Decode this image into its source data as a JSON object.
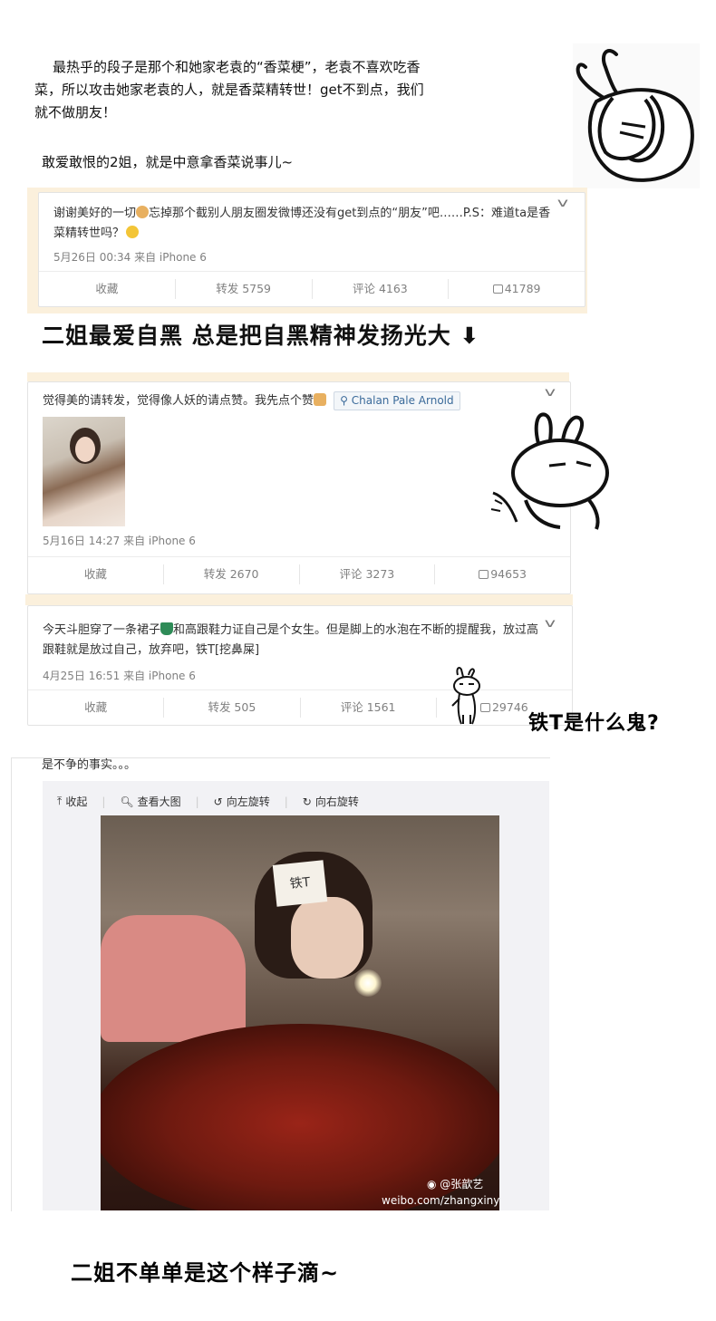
{
  "intro": {
    "line1": "最热乎的段子是那个和她家老袁的“香菜梗”，老袁不喜欢吃香菜，所以攻击她家老袁的人，就是香菜精转世！get不到点，我们就不做朋友！",
    "line2": "敢爱敢恨的2姐，就是中意拿香菜说事儿~"
  },
  "post1": {
    "text_a": "谢谢美好的一切",
    "text_b": "忘掉那个截别人朋友圈发微博还没有get到点的“朋友”吧……P.S：难道ta是香菜精转世吗？",
    "meta": "5月26日 00:34 来自 iPhone 6",
    "actions": [
      "收藏",
      "转发 5759",
      "评论 4163",
      "41789"
    ]
  },
  "caption1": "二姐最爱自黑 总是把自黑精神发扬光大 ⬇",
  "post2": {
    "text": "觉得美的请转发，觉得像人妖的请点赞。我先点个赞",
    "location": "Chalan Pale Arnold",
    "meta": "5月16日 14:27 来自 iPhone 6",
    "actions": [
      "收藏",
      "转发 2670",
      "评论 3273",
      "94653"
    ]
  },
  "post3": {
    "text_a": "今天斗胆穿了一条裙子",
    "text_b": "和高跟鞋力证自己是个女生。但是脚上的水泡在不断的提醒我，放过高跟鞋就是放过自己，放弃吧，铁T[挖鼻屎]",
    "meta": "4月25日 16:51 来自 iPhone 6",
    "actions": [
      "收藏",
      "转发 505",
      "评论 1561",
      "29746"
    ]
  },
  "caption2": "铁T是什么鬼?",
  "post4": {
    "text": "是不争的事实。。。",
    "toolbar": [
      "收起",
      "查看大图",
      "向左旋转",
      "向右旋转"
    ],
    "sticky_note": "铁T",
    "watermark_handle": "@张歆艺",
    "watermark_url": "weibo.com/zhangxinyi"
  },
  "caption3": "二姐不单单是这个样子滴~",
  "colors": {
    "frame": "#fbf0dc",
    "link": "#3a6a9a",
    "meta": "#808080"
  },
  "icons": [
    "rabbit-cover-face-icon",
    "rabbit-smug-icon",
    "rabbit-small-icon",
    "pray-icon",
    "laugh-cry-icon",
    "thumbs-up-icon",
    "location-pin-icon",
    "dress-icon",
    "chevron-down-icon",
    "collapse-icon",
    "search-icon",
    "rotate-left-icon",
    "rotate-right-icon",
    "weibo-logo-icon"
  ]
}
